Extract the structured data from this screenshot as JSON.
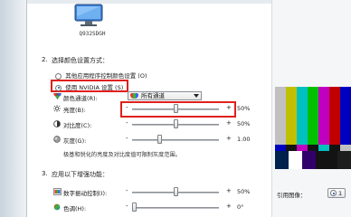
{
  "display": {
    "monitor_name": "Q932SDGH"
  },
  "section2": {
    "number": "2.",
    "title": "选择颜色设置方式：",
    "option_other": "其他应用程序控制颜色设置 (O)",
    "option_nvidia": "使用 NVIDIA 设置 (S)",
    "option_nvidia_selected": true
  },
  "color_channel": {
    "label": "颜色通道(R):",
    "value": "所有通道"
  },
  "sliders": {
    "brightness": {
      "label": "亮度(B):",
      "minus": "-",
      "plus": "+",
      "value": "50%",
      "level": 0.5
    },
    "contrast": {
      "label": "对比度(C):",
      "minus": "-",
      "plus": "+",
      "value": "50%",
      "level": 0.5
    },
    "gamma": {
      "label": "灰度(G):",
      "minus": "-",
      "plus": "+",
      "value": "1.00",
      "level": 0.5
    }
  },
  "note": "极基和锐化的亮度及对比度值可限制灰度范围。",
  "section3": {
    "number": "3.",
    "title": "应用以下增强功能：",
    "digital_vibrance": {
      "label": "数字振动控制(I):",
      "minus": "-",
      "plus": "+",
      "value": "50%",
      "level": 0.5
    },
    "hue": {
      "label": "色调(H):",
      "minus": "-",
      "plus": "+",
      "value": "0°",
      "level": 0.0
    }
  },
  "reference": {
    "label": "引用图像：",
    "radio_value": "1"
  },
  "colors": {
    "highlight_red": "#e0201c",
    "radio_dot": "#1b4f9c",
    "sidebar": "#d3dbe3"
  }
}
